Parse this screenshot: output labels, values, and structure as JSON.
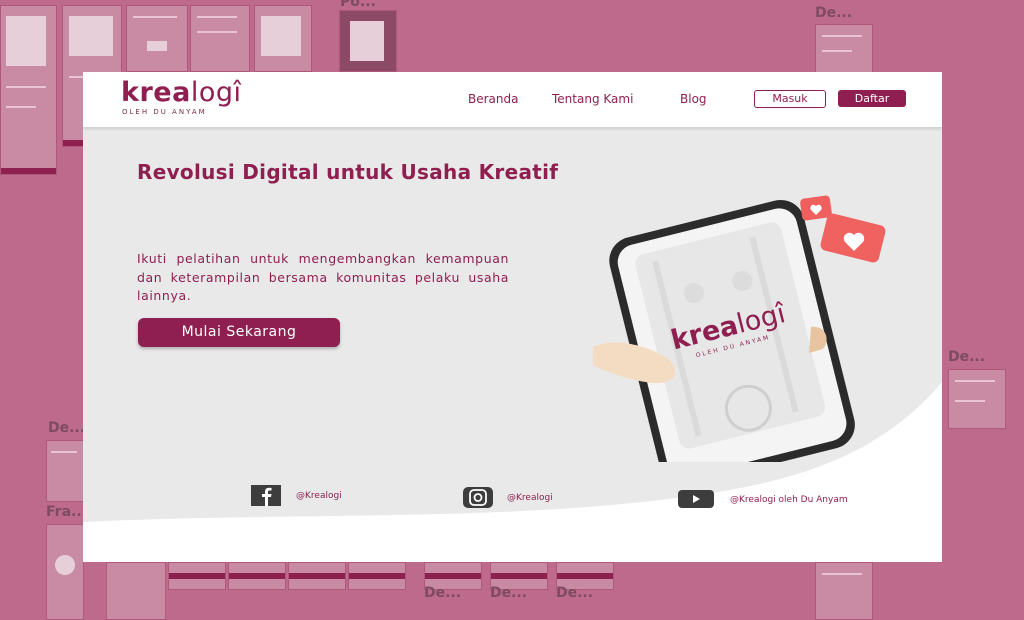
{
  "canvas": {
    "frame_labels": [
      "Po...",
      "De...",
      "De...",
      "De...",
      "Fra...",
      "De...",
      "De...",
      "De..."
    ]
  },
  "app": {
    "logo": {
      "krea": "krea",
      "logi": "logî",
      "tagline": "OLEH DU ANYAM"
    },
    "nav": {
      "links": [
        "Beranda",
        "Tentang Kami",
        "Blog"
      ],
      "login_label": "Masuk",
      "register_label": "Daftar"
    },
    "hero": {
      "title": "Revolusi Digital untuk Usaha Kreatif",
      "description": "Ikuti pelatihan untuk mengembangkan kemampuan dan keterampilan bersama komunitas pelaku usaha lainnya.",
      "cta_label": "Mulai Sekarang"
    },
    "phone_screen": {
      "logo_krea": "krea",
      "logo_logi": "logî",
      "tagline": "OLEH DU ANYAM"
    },
    "social": [
      {
        "icon": "facebook-icon",
        "handle": "@Krealogi"
      },
      {
        "icon": "instagram-icon",
        "handle": "@Krealogi"
      },
      {
        "icon": "youtube-icon",
        "handle": "@Krealogi oleh Du Anyam"
      }
    ]
  },
  "colors": {
    "brand": "#8f1f50",
    "canvas_bg": "#bd6a8c",
    "hero_bg": "#e9e9e9",
    "accent_heart": "#f06a67"
  }
}
